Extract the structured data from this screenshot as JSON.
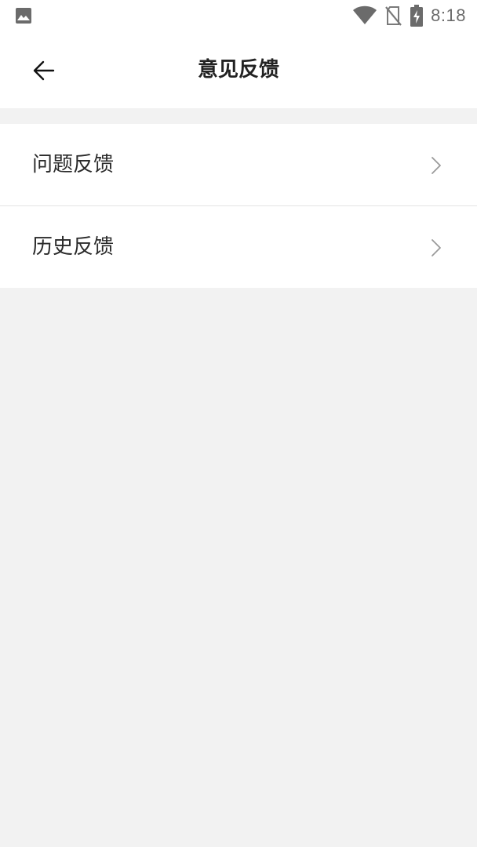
{
  "status_bar": {
    "time": "8:18",
    "icons": [
      "image-icon",
      "wifi-icon",
      "no-sim-icon",
      "battery-charging-icon"
    ]
  },
  "app_bar": {
    "title": "意见反馈",
    "back_icon": "arrow-left-icon"
  },
  "menu": {
    "items": [
      {
        "label": "问题反馈",
        "icon": "chevron-right-icon"
      },
      {
        "label": "历史反馈",
        "icon": "chevron-right-icon"
      }
    ]
  },
  "colors": {
    "background": "#f2f2f2",
    "surface": "#ffffff",
    "text": "#222222",
    "chevron": "#9a9a9a",
    "status_icons": "#6b6b6b"
  }
}
